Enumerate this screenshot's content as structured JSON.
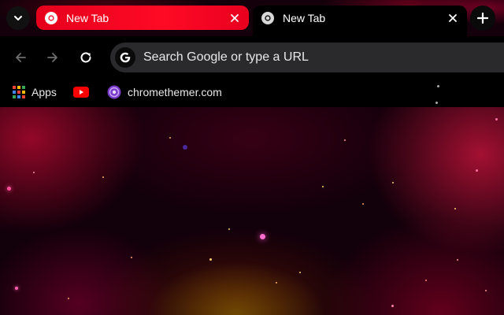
{
  "tabs": [
    {
      "title": "New Tab",
      "state": "inactive"
    },
    {
      "title": "New Tab",
      "state": "active"
    }
  ],
  "tab_strip": {
    "tab_search_icon": "chevron-down-icon",
    "new_tab_icon": "plus-icon",
    "close_icon": "close-icon"
  },
  "toolbar": {
    "back_icon": "arrow-left-icon",
    "forward_icon": "arrow-right-icon",
    "reload_icon": "reload-icon"
  },
  "omnibox": {
    "placeholder": "Search Google or type a URL",
    "engine_icon": "google-g-icon"
  },
  "bookmarks": [
    {
      "label": "Apps",
      "icon": "apps-grid-icon"
    },
    {
      "label": "",
      "icon": "youtube-icon"
    },
    {
      "label": "chromethemer.com",
      "icon": "chromethemer-icon"
    }
  ],
  "colors": {
    "inactive_tab": "#ff0a25",
    "active_tab": "#000000",
    "omnibox_bg": "#2a2a2c",
    "content_bg": "#12000a"
  }
}
